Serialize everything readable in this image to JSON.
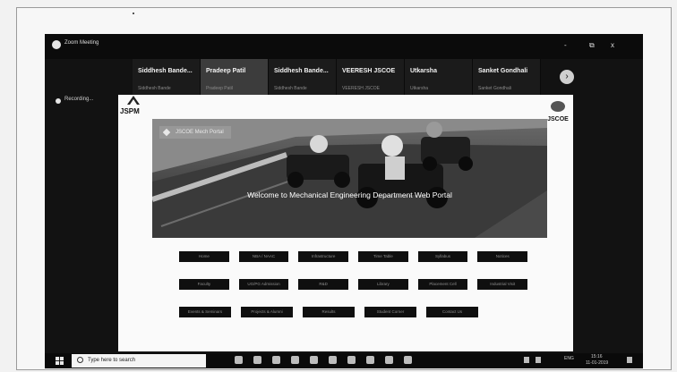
{
  "window": {
    "title": "Zoom Meeting",
    "minimize": "-",
    "restore": "⧉",
    "close": "x"
  },
  "participants": [
    {
      "name": "Siddhesh  Bande...",
      "sub": "Siddhesh Bande"
    },
    {
      "name": "Pradeep Patil",
      "sub": "Pradeep Patil"
    },
    {
      "name": "Siddhesh  Bande...",
      "sub": "Siddhesh Bande"
    },
    {
      "name": "VEERESH JSCOE",
      "sub": "VEERESH JSCOE"
    },
    {
      "name": "Utkarsha",
      "sub": "Utkarsha"
    },
    {
      "name": "Sanket Gondhali",
      "sub": "Sanket Gondhali"
    }
  ],
  "next_page": "›",
  "recording": "Recording...",
  "shared": {
    "left_logo": "JSPM",
    "right_logo": "JSCOE",
    "site_badge": "JSCOE Mech Portal",
    "welcome": "Welcome to Mechanical Engineering Department Web Portal",
    "menu_rows": [
      [
        "Home",
        "NBA / NAAC",
        "Infrastructure",
        "Time Table",
        "Syllabus",
        "Notices"
      ],
      [
        "Faculty",
        "UG/PG Admission",
        "R&D",
        "Library",
        "Placement Cell",
        "Industrial Visit"
      ],
      [
        "Events & Seminars",
        "Projects & Alumni",
        "Results",
        "Student Corner",
        "Contact Us"
      ]
    ]
  },
  "taskbar": {
    "search_placeholder": "Type here to search",
    "tray_lang": "ENG",
    "time": "15:16",
    "date": "11-01-2019"
  }
}
